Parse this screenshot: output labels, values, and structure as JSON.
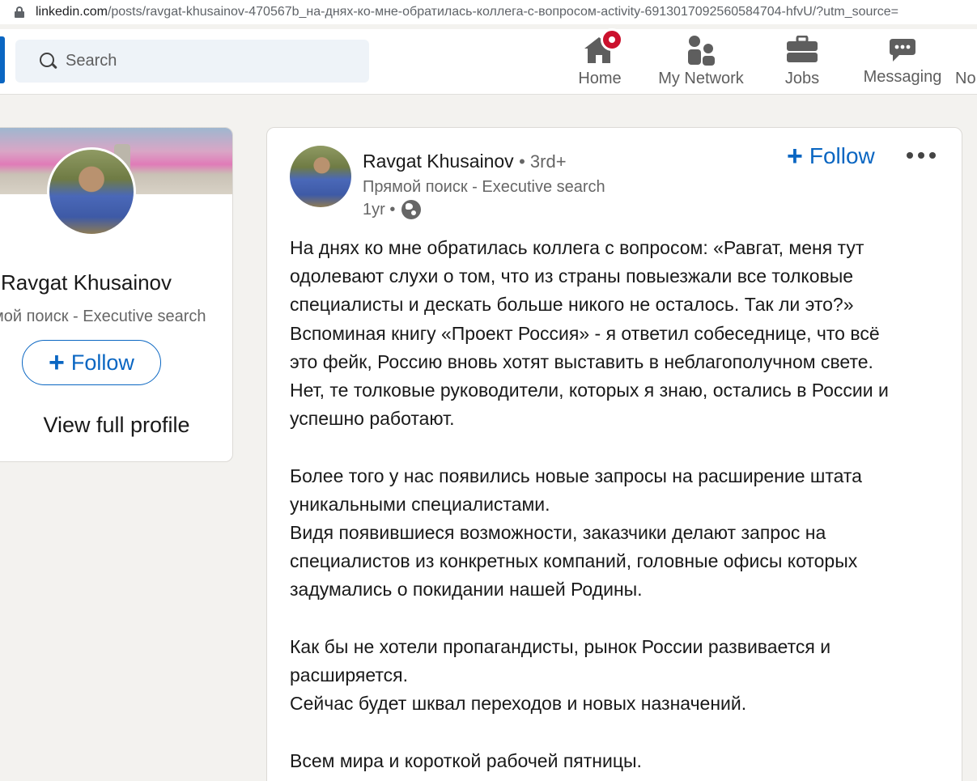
{
  "browser": {
    "url_host": "linkedin.com",
    "url_path": "/posts/ravgat-khusainov-470567b_на-днях-ко-мне-обратилась-коллега-с-вопросом-activity-6913017092560584704-hfvU/?utm_source="
  },
  "nav": {
    "search_placeholder": "Search",
    "items": [
      {
        "label": "Home",
        "icon": "home-icon"
      },
      {
        "label": "My Network",
        "icon": "network-icon"
      },
      {
        "label": "Jobs",
        "icon": "briefcase-icon"
      },
      {
        "label": "Messaging",
        "icon": "messaging-icon"
      },
      {
        "label": "No",
        "icon": "notifications-icon"
      }
    ]
  },
  "profile_card": {
    "name": "Ravgat Khusainov",
    "headline": "мой поиск - Executive search",
    "follow_label": "Follow",
    "view_profile_label": "View full profile"
  },
  "post": {
    "author_name": "Ravgat Khusainov",
    "degree": "• 3rd+",
    "headline": "Прямой поиск - Executive search",
    "time": "1yr •",
    "follow_label": "Follow",
    "body_lines": [
      "На днях ко мне обратилась коллега с вопросом: «Равгат, меня тут",
      "одолевают слухи о том, что из страны повыезжали все толковые",
      "специалисты и дескать больше никого не осталось. Так ли это?»",
      "Вспоминая книгу «Проект Россия» - я ответил собеседнице, что всё",
      "это фейк, Россию вновь хотят выставить в неблагополучном свете.",
      "Нет, те толковые руководители, которых я знаю, остались в России и",
      "успешно работают.",
      "",
      "Более того у нас появились новые запросы на расширение штата",
      "уникальными специалистами.",
      "Видя появившиеся возможности, заказчики делают запрос на",
      "специалистов из конкретных компаний, головные офисы которых",
      "задумались о покидании нашей Родины.",
      "",
      "Как бы не хотели пропагандисты, рынок России развивается и",
      "расширяется.",
      "Сейчас будет шквал переходов и новых назначений.",
      "",
      "Всем мира и короткой рабочей пятницы."
    ]
  },
  "colors": {
    "accent": "#0a66c2",
    "badge": "#cb112d",
    "page_bg": "#f3f2ef"
  }
}
